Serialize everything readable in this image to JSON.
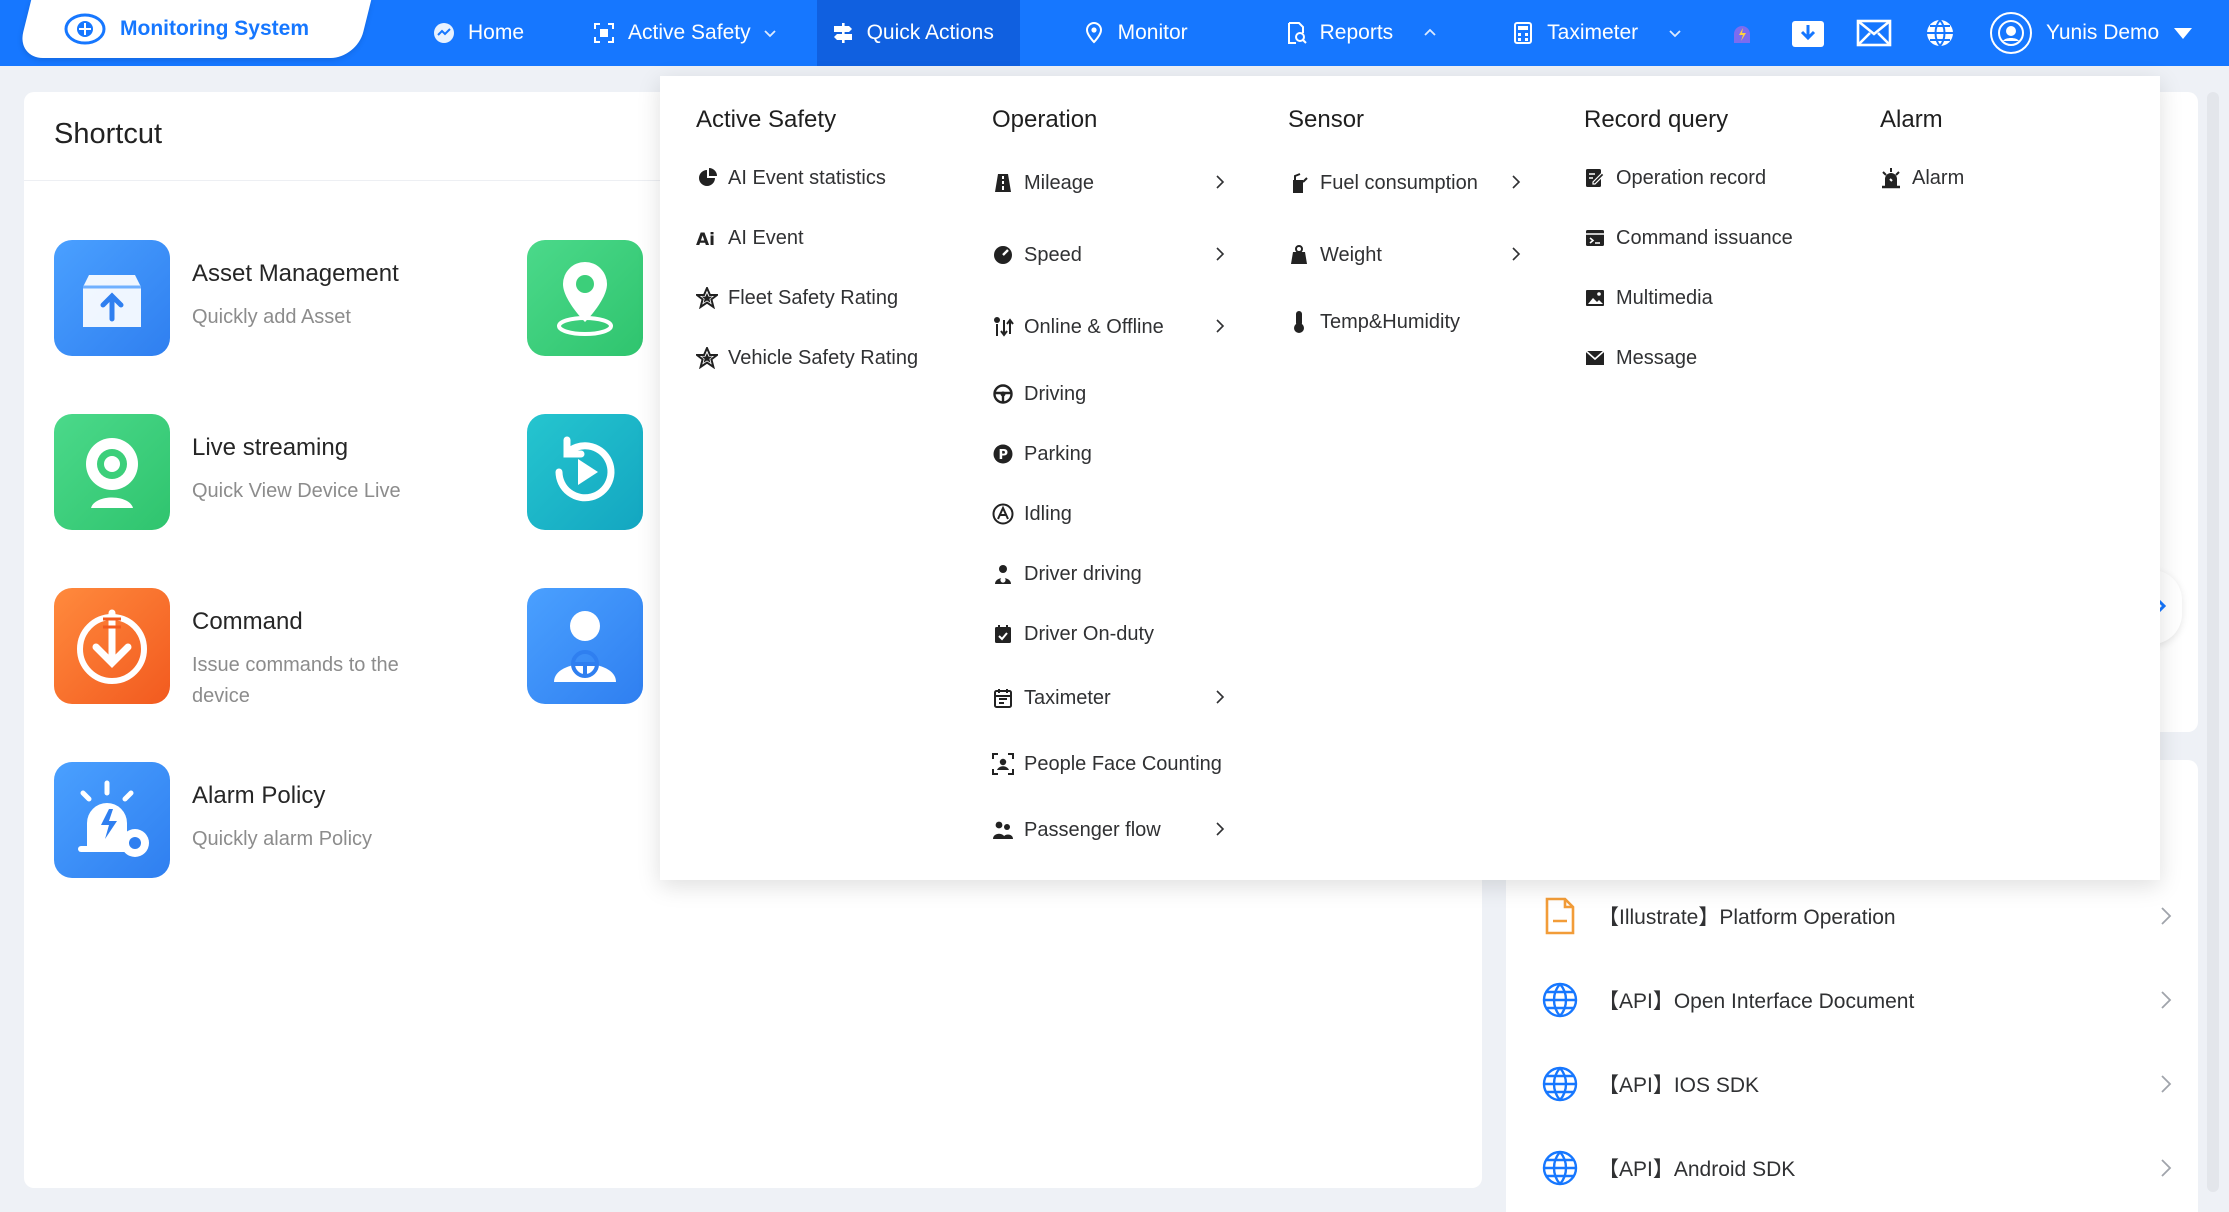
{
  "app": {
    "logo_text": "Monitoring System"
  },
  "nav": {
    "items": [
      {
        "label": "Home"
      },
      {
        "label": "Active Safety"
      },
      {
        "label": "Quick Actions"
      },
      {
        "label": "Monitor"
      },
      {
        "label": "Reports"
      },
      {
        "label": "Taximeter"
      }
    ],
    "user_name": "Yunis Demo"
  },
  "shortcut": {
    "title": "Shortcut",
    "items": [
      {
        "name": "Asset Management",
        "desc": "Quickly add Asset"
      },
      {
        "name": "Live streaming",
        "desc": "Quick View Device Live"
      },
      {
        "name": "Command",
        "desc": "Issue commands to the device"
      },
      {
        "name": "Alarm Policy",
        "desc": "Quickly alarm Policy"
      }
    ]
  },
  "menu": {
    "active_safety": {
      "title": "Active Safety",
      "items": [
        "AI Event statistics",
        "AI Event",
        "Fleet Safety Rating",
        "Vehicle Safety Rating"
      ]
    },
    "operation": {
      "title": "Operation",
      "items": [
        "Mileage",
        "Speed",
        "Online & Offline",
        "Driving",
        "Parking",
        "Idling",
        "Driver driving",
        "Driver On-duty",
        "Taximeter",
        "People Face Counting",
        "Passenger flow"
      ]
    },
    "sensor": {
      "title": "Sensor",
      "items": [
        "Fuel consumption",
        "Weight",
        "Temp&Humidity"
      ]
    },
    "record_query": {
      "title": "Record query",
      "items": [
        "Operation record",
        "Command issuance",
        "Multimedia",
        "Message"
      ]
    },
    "alarm": {
      "title": "Alarm",
      "items": [
        "Alarm"
      ]
    }
  },
  "docs": {
    "items": [
      "【Illustrate】Platform Operation",
      "【API】Open Interface Document",
      "【API】IOS SDK",
      "【API】Android SDK"
    ]
  },
  "colors": {
    "primary": "#1677ff",
    "nav_active": "#1060e0",
    "blue_tile": "#3b8ef5",
    "green_tile": "#3ccf7a",
    "teal_tile": "#19b3c8",
    "orange_tile": "#f46c2c",
    "doc_orange": "#f29c38"
  }
}
